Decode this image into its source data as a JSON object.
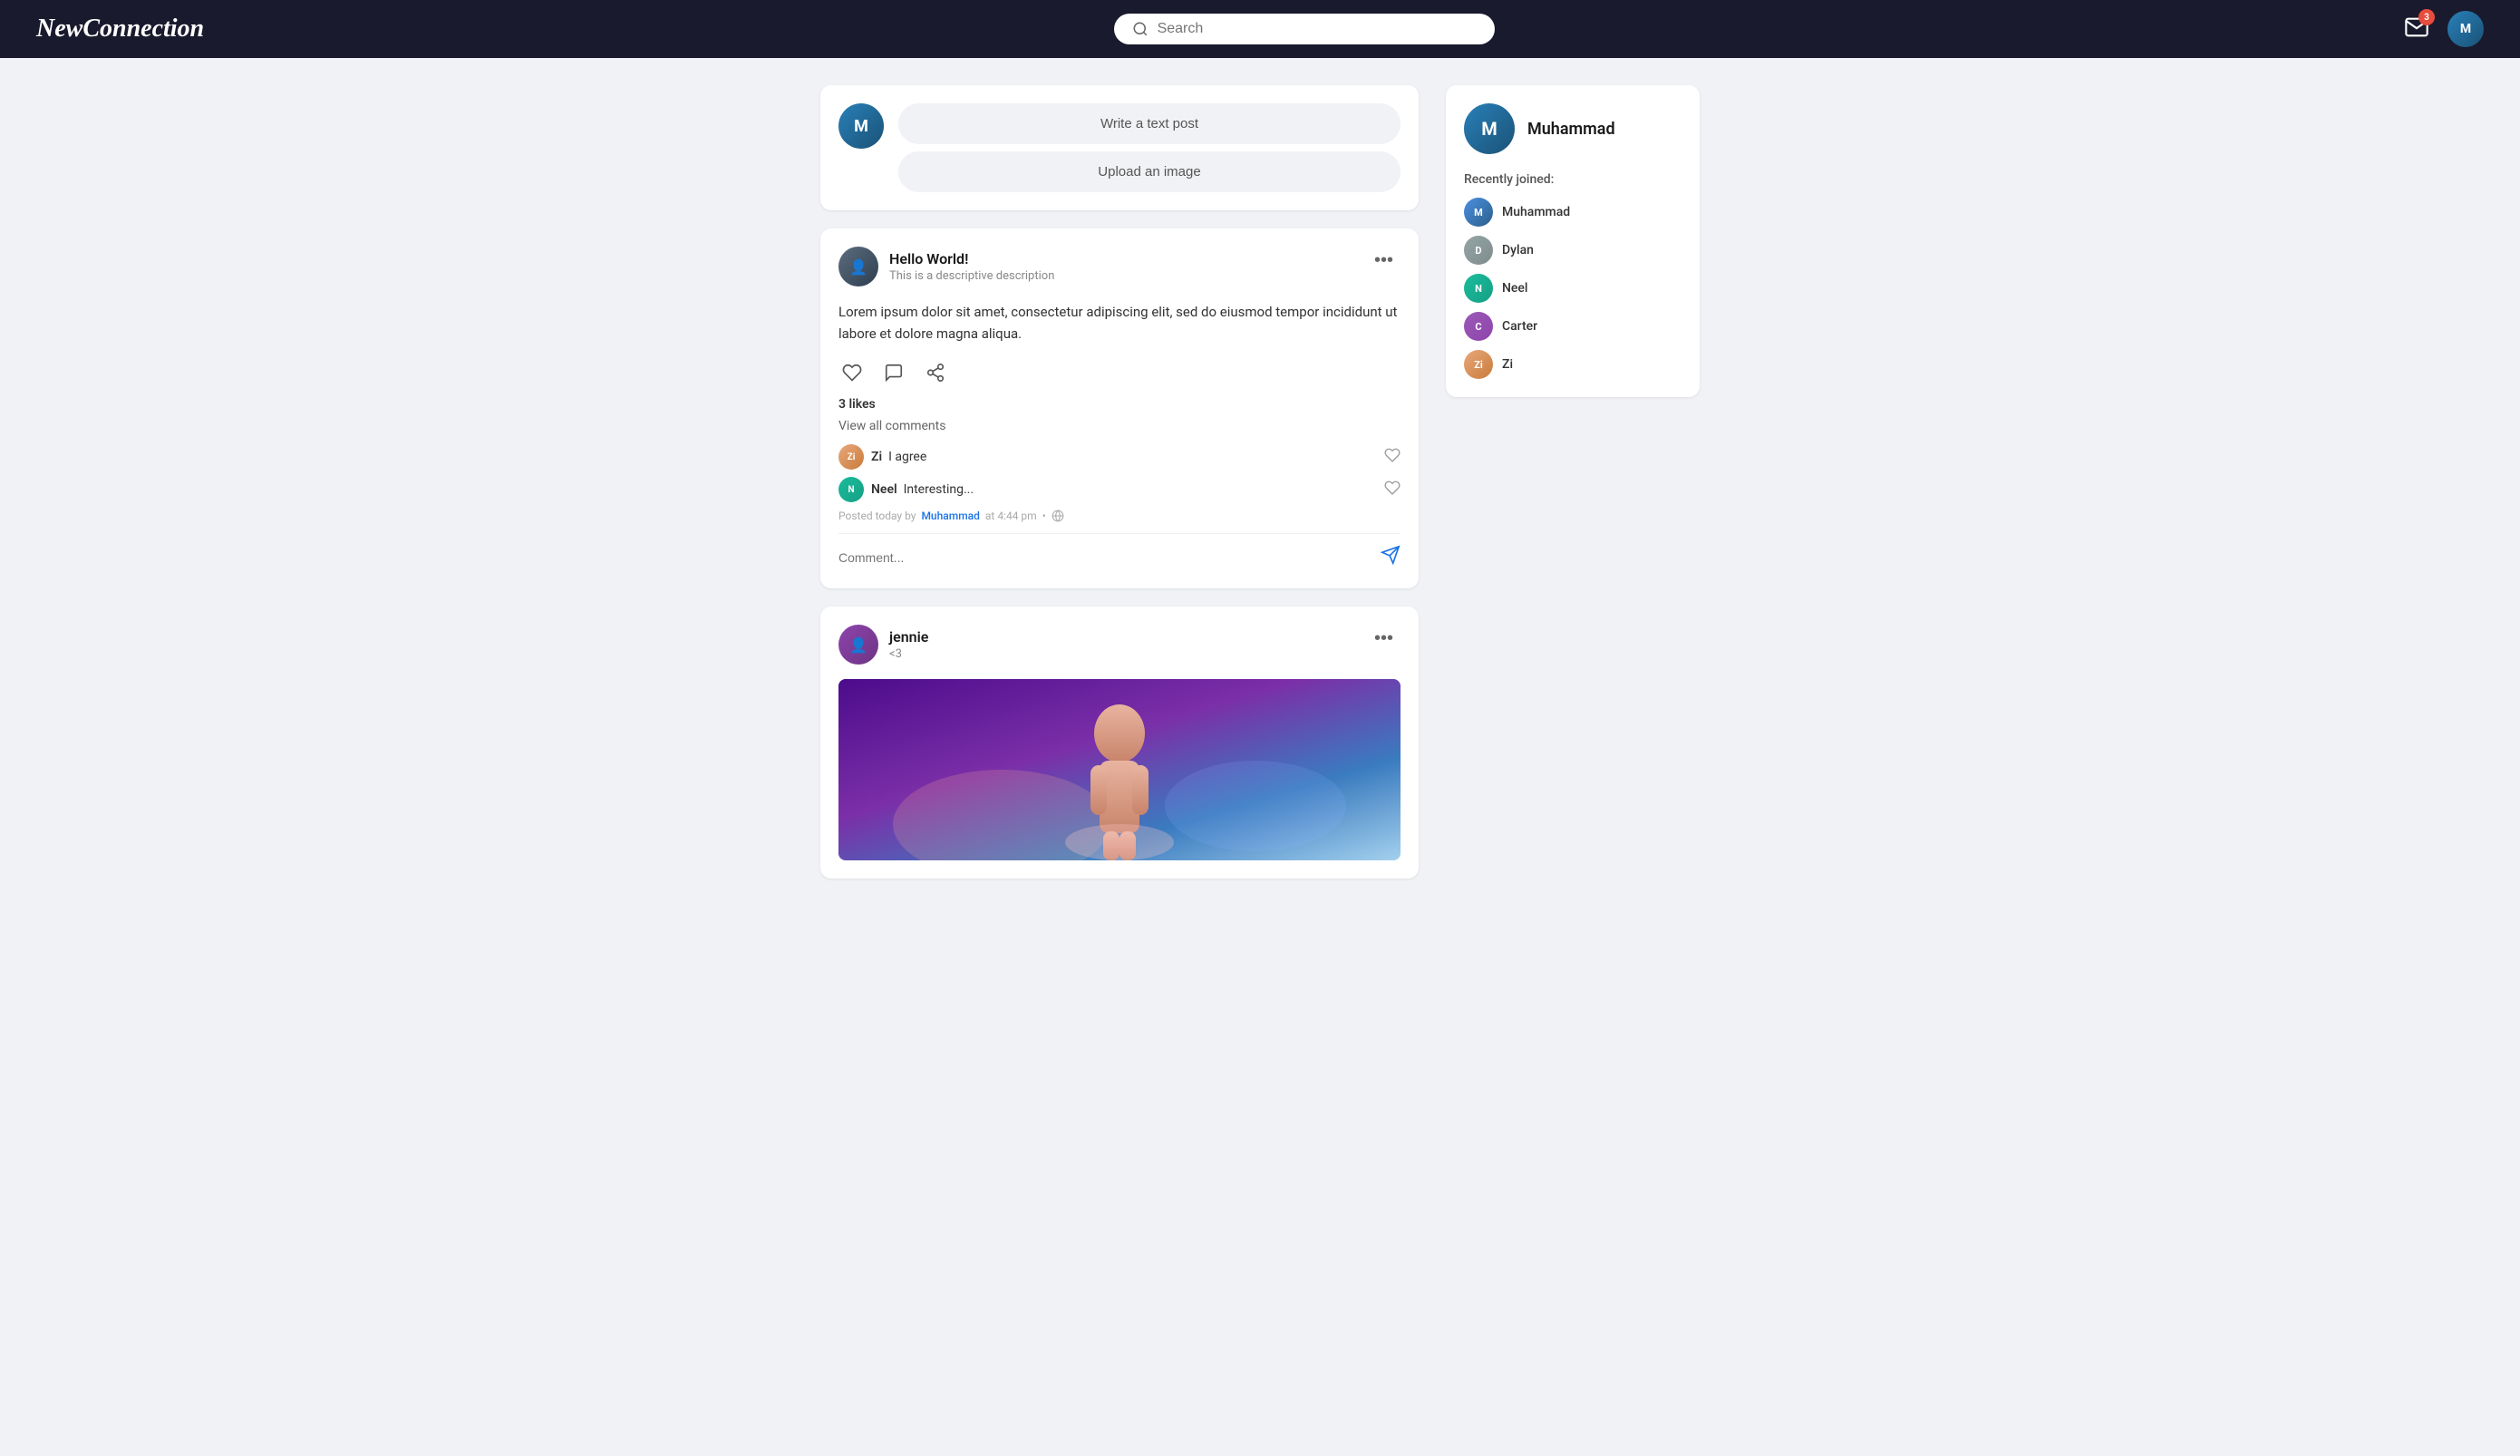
{
  "app": {
    "name": "NewConnection",
    "logo": "NewConnection"
  },
  "navbar": {
    "search_placeholder": "Search",
    "notification_count": "3"
  },
  "create_post": {
    "text_post_label": "Write a text post",
    "upload_image_label": "Upload an image"
  },
  "posts": [
    {
      "id": "post-1",
      "author": "Hello World!",
      "subtitle": "This is a descriptive description",
      "content": "Lorem ipsum dolor sit amet, consectetur adipiscing elit, sed do eiusmod tempor incididunt ut labore et dolore magna aliqua.",
      "likes_count": "3 likes",
      "view_comments": "View all comments",
      "comments": [
        {
          "author": "Zi",
          "text": "I agree",
          "avatar_label": "Zi"
        },
        {
          "author": "Neel",
          "text": "Interesting...",
          "avatar_label": "N"
        }
      ],
      "post_meta": "Posted today by",
      "post_author_link": "Muhammad",
      "post_time": "at 4:44 pm",
      "comment_placeholder": "Comment...",
      "has_image": false
    },
    {
      "id": "post-2",
      "author": "jennie",
      "subtitle": "<3",
      "content": "",
      "has_image": true
    }
  ],
  "sidebar": {
    "username": "Muhammad",
    "recently_joined_label": "Recently joined:",
    "members": [
      {
        "name": "Muhammad",
        "avatar_label": "M",
        "color": "av-blue"
      },
      {
        "name": "Dylan",
        "avatar_label": "D",
        "color": "av-gray"
      },
      {
        "name": "Neel",
        "avatar_label": "N",
        "color": "av-teal"
      },
      {
        "name": "Carter",
        "avatar_label": "C",
        "color": "av-purple"
      },
      {
        "name": "Zi",
        "avatar_label": "Zi",
        "color": "av-orange"
      }
    ]
  },
  "icons": {
    "heart": "♡",
    "heart_filled": "♥",
    "comment": "💬",
    "share": "↗",
    "more": "•••",
    "send": "➤",
    "search": "🔍",
    "globe": "🌐",
    "bell": "✉"
  }
}
